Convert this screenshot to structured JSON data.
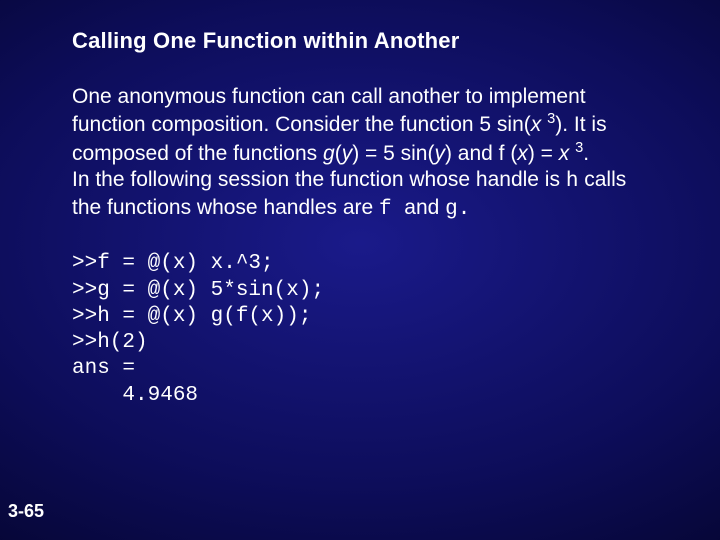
{
  "title": "Calling One Function within Another",
  "paragraph": {
    "t1": "One anonymous function can call another to implement function composition. Consider the function 5 sin(",
    "x1": "x",
    "sp1": " ",
    "sup1": "3",
    "t2": "). It is composed of the functions ",
    "g": "g",
    "t3": "(",
    "y1": "y",
    "t4": ") = 5 sin(",
    "y2": "y",
    "t5": ") and f (",
    "x2": "x",
    "t6": ") = ",
    "x3": "x",
    "sp2": " ",
    "sup2": "3",
    "t7": ".",
    "br": "",
    "t8": "In the following session the function whose handle is ",
    "h1": "h",
    "t9": " calls the functions whose handles are ",
    "f1": "f ",
    "t10": "and ",
    "g1": "g."
  },
  "code": {
    "l1": ">>f = @(x) x.^3;",
    "l2": ">>g = @(x) 5*sin(x);",
    "l3": ">>h = @(x) g(f(x));",
    "l4": ">>h(2)",
    "l5": "ans =",
    "l6": "    4.9468"
  },
  "page": "3-65"
}
